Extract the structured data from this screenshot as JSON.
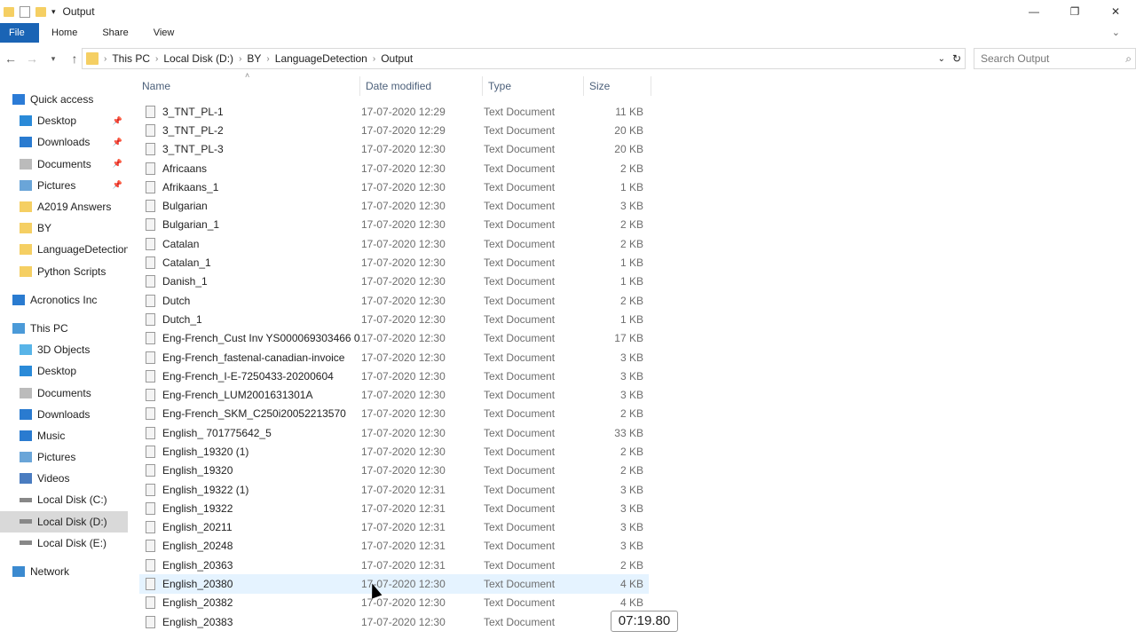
{
  "window": {
    "title": "Output",
    "minimize": "—",
    "restore": "❐",
    "close": "✕"
  },
  "ribbon": {
    "tabs": [
      "File",
      "Home",
      "Share",
      "View"
    ]
  },
  "address": {
    "crumbs": [
      "This PC",
      "Local Disk (D:)",
      "BY",
      "LanguageDetection",
      "Output"
    ],
    "search_placeholder": "Search Output"
  },
  "sidebar": {
    "items": [
      {
        "label": "Quick access",
        "icon": "star-icon",
        "level": 0,
        "pinned": false
      },
      {
        "label": "Desktop",
        "icon": "desktop-icon",
        "level": 1,
        "pinned": true
      },
      {
        "label": "Downloads",
        "icon": "download-icon",
        "level": 1,
        "pinned": true
      },
      {
        "label": "Documents",
        "icon": "documents-icon",
        "level": 1,
        "pinned": true
      },
      {
        "label": "Pictures",
        "icon": "pictures-icon",
        "level": 1,
        "pinned": true
      },
      {
        "label": "A2019 Answers",
        "icon": "folder-icon",
        "level": 1,
        "pinned": false
      },
      {
        "label": "BY",
        "icon": "folder-icon",
        "level": 1,
        "pinned": false
      },
      {
        "label": "LanguageDetection",
        "icon": "folder-icon",
        "level": 1,
        "pinned": false
      },
      {
        "label": "Python Scripts",
        "icon": "folder-icon",
        "level": 1,
        "pinned": false
      },
      {
        "label": "",
        "icon": "",
        "level": 0,
        "pinned": false
      },
      {
        "label": "Acronotics Inc",
        "icon": "cloud-icon",
        "level": 0,
        "pinned": false
      },
      {
        "label": "",
        "icon": "",
        "level": 0,
        "pinned": false
      },
      {
        "label": "This PC",
        "icon": "computer-icon",
        "level": 0,
        "pinned": false
      },
      {
        "label": "3D Objects",
        "icon": "3d-objects-icon",
        "level": 1,
        "pinned": false
      },
      {
        "label": "Desktop",
        "icon": "desktop-icon",
        "level": 1,
        "pinned": false
      },
      {
        "label": "Documents",
        "icon": "documents-icon",
        "level": 1,
        "pinned": false
      },
      {
        "label": "Downloads",
        "icon": "download-icon",
        "level": 1,
        "pinned": false
      },
      {
        "label": "Music",
        "icon": "music-icon",
        "level": 1,
        "pinned": false
      },
      {
        "label": "Pictures",
        "icon": "pictures-icon",
        "level": 1,
        "pinned": false
      },
      {
        "label": "Videos",
        "icon": "videos-icon",
        "level": 1,
        "pinned": false
      },
      {
        "label": "Local Disk (C:)",
        "icon": "drive-icon",
        "level": 1,
        "pinned": false
      },
      {
        "label": "Local Disk (D:)",
        "icon": "drive-icon",
        "level": 1,
        "pinned": false,
        "selected": true
      },
      {
        "label": "Local Disk (E:)",
        "icon": "drive-icon",
        "level": 1,
        "pinned": false
      },
      {
        "label": "",
        "icon": "",
        "level": 0,
        "pinned": false
      },
      {
        "label": "Network",
        "icon": "network-icon",
        "level": 0,
        "pinned": false
      }
    ]
  },
  "columns": {
    "name": "Name",
    "date": "Date modified",
    "type": "Type",
    "size": "Size"
  },
  "files": [
    {
      "name": "3_TNT_PL-1",
      "date": "17-07-2020 12:29",
      "type": "Text Document",
      "size": "11 KB"
    },
    {
      "name": "3_TNT_PL-2",
      "date": "17-07-2020 12:29",
      "type": "Text Document",
      "size": "20 KB"
    },
    {
      "name": "3_TNT_PL-3",
      "date": "17-07-2020 12:30",
      "type": "Text Document",
      "size": "20 KB"
    },
    {
      "name": "Africaans",
      "date": "17-07-2020 12:30",
      "type": "Text Document",
      "size": "2 KB"
    },
    {
      "name": "Afrikaans_1",
      "date": "17-07-2020 12:30",
      "type": "Text Document",
      "size": "1 KB"
    },
    {
      "name": "Bulgarian",
      "date": "17-07-2020 12:30",
      "type": "Text Document",
      "size": "3 KB"
    },
    {
      "name": "Bulgarian_1",
      "date": "17-07-2020 12:30",
      "type": "Text Document",
      "size": "2 KB"
    },
    {
      "name": "Catalan",
      "date": "17-07-2020 12:30",
      "type": "Text Document",
      "size": "2 KB"
    },
    {
      "name": "Catalan_1",
      "date": "17-07-2020 12:30",
      "type": "Text Document",
      "size": "1 KB"
    },
    {
      "name": "Danish_1",
      "date": "17-07-2020 12:30",
      "type": "Text Document",
      "size": "1 KB"
    },
    {
      "name": "Dutch",
      "date": "17-07-2020 12:30",
      "type": "Text Document",
      "size": "2 KB"
    },
    {
      "name": "Dutch_1",
      "date": "17-07-2020 12:30",
      "type": "Text Document",
      "size": "1 KB"
    },
    {
      "name": "Eng-French_Cust Inv YS000069303466  0...",
      "date": "17-07-2020 12:30",
      "type": "Text Document",
      "size": "17 KB"
    },
    {
      "name": "Eng-French_fastenal-canadian-invoice",
      "date": "17-07-2020 12:30",
      "type": "Text Document",
      "size": "3 KB"
    },
    {
      "name": "Eng-French_I-E-7250433-20200604",
      "date": "17-07-2020 12:30",
      "type": "Text Document",
      "size": "3 KB"
    },
    {
      "name": "Eng-French_LUM2001631301A",
      "date": "17-07-2020 12:30",
      "type": "Text Document",
      "size": "3 KB"
    },
    {
      "name": "Eng-French_SKM_C250i20052213570",
      "date": "17-07-2020 12:30",
      "type": "Text Document",
      "size": "2 KB"
    },
    {
      "name": "English_ 701775642_5",
      "date": "17-07-2020 12:30",
      "type": "Text Document",
      "size": "33 KB"
    },
    {
      "name": "English_19320 (1)",
      "date": "17-07-2020 12:30",
      "type": "Text Document",
      "size": "2 KB"
    },
    {
      "name": "English_19320",
      "date": "17-07-2020 12:30",
      "type": "Text Document",
      "size": "2 KB"
    },
    {
      "name": "English_19322 (1)",
      "date": "17-07-2020 12:31",
      "type": "Text Document",
      "size": "3 KB"
    },
    {
      "name": "English_19322",
      "date": "17-07-2020 12:31",
      "type": "Text Document",
      "size": "3 KB"
    },
    {
      "name": "English_20211",
      "date": "17-07-2020 12:31",
      "type": "Text Document",
      "size": "3 KB"
    },
    {
      "name": "English_20248",
      "date": "17-07-2020 12:31",
      "type": "Text Document",
      "size": "3 KB"
    },
    {
      "name": "English_20363",
      "date": "17-07-2020 12:31",
      "type": "Text Document",
      "size": "2 KB"
    },
    {
      "name": "English_20380",
      "date": "17-07-2020 12:30",
      "type": "Text Document",
      "size": "4 KB",
      "highlighted": true
    },
    {
      "name": "English_20382",
      "date": "17-07-2020 12:30",
      "type": "Text Document",
      "size": "4 KB"
    },
    {
      "name": "English_20383",
      "date": "17-07-2020 12:30",
      "type": "Text Document",
      "size": ""
    }
  ],
  "overlay": {
    "timestamp": "07:19.80"
  }
}
